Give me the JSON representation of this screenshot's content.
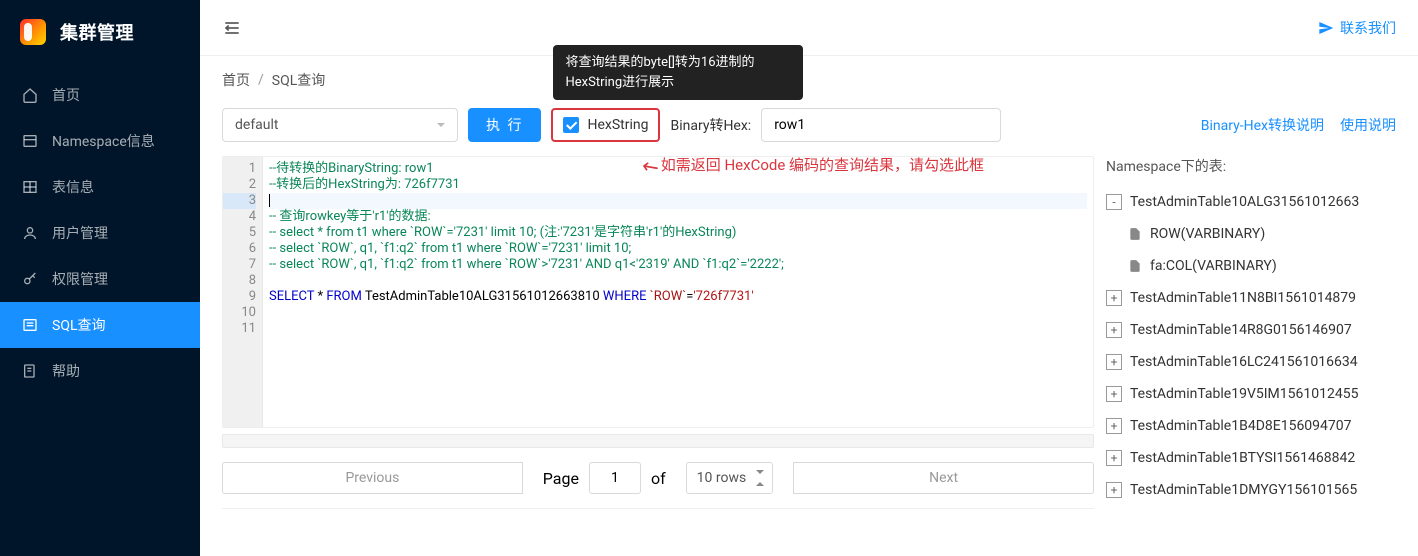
{
  "logo": {
    "title": "集群管理"
  },
  "sidebar": {
    "items": [
      {
        "label": "首页",
        "icon": "home-icon",
        "active": false
      },
      {
        "label": "Namespace信息",
        "icon": "list-icon",
        "active": false
      },
      {
        "label": "表信息",
        "icon": "table-icon",
        "active": false
      },
      {
        "label": "用户管理",
        "icon": "user-icon",
        "active": false
      },
      {
        "label": "权限管理",
        "icon": "key-icon",
        "active": false
      },
      {
        "label": "SQL查询",
        "icon": "sql-icon",
        "active": true
      },
      {
        "label": "帮助",
        "icon": "help-icon",
        "active": false
      }
    ]
  },
  "topbar": {
    "contact": "联系我们"
  },
  "breadcrumb": {
    "home": "首页",
    "current": "SQL查询"
  },
  "controls": {
    "namespace_select": "default",
    "execute_label": "执 行",
    "hexstring_label": "HexString",
    "hexstring_tooltip": "将查询结果的byte[]转为16进制的HexString进行展示",
    "binary_label": "Binary转Hex:",
    "binary_input": "row1",
    "link_convert": "Binary-Hex转换说明",
    "link_usage": "使用说明",
    "annotation": "如需返回 HexCode 编码的查询结果，请勾选此框"
  },
  "editor": {
    "lines": [
      {
        "n": 1,
        "html": "<span class='c-cmt'>--待转换的BinaryString: row1</span>"
      },
      {
        "n": 2,
        "html": "<span class='c-cmt'>--转换后的HexString为: 726f7731</span>"
      },
      {
        "n": 3,
        "html": "<span class='cursor'></span>",
        "cur": true
      },
      {
        "n": 4,
        "html": "<span class='c-cmt'>-- 查询rowkey等于'r1'的数据:</span>"
      },
      {
        "n": 5,
        "html": "<span class='c-cmt'>-- select * from t1 where `ROW`='7231' limit 10; (注:'7231'是字符串'r1'的HexString)</span>"
      },
      {
        "n": 6,
        "html": "<span class='c-cmt'>-- select `ROW`, q1, `f1:q2` from t1 where `ROW`='7231' limit 10;</span>"
      },
      {
        "n": 7,
        "html": "<span class='c-cmt'>-- select `ROW`, q1, `f1:q2` from t1 where `ROW`>'7231' AND q1<'2319' AND `f1:q2`='2222';</span>"
      },
      {
        "n": 8,
        "html": ""
      },
      {
        "n": 9,
        "html": "<span class='c-kw'>SELECT</span> * <span class='c-kw'>FROM</span> TestAdminTable10ALG31561012663810 <span class='c-kw'>WHERE</span> <span class='c-col'>`ROW`</span>=<span class='c-str'>'726f7731'</span>"
      },
      {
        "n": 10,
        "html": ""
      },
      {
        "n": 11,
        "html": ""
      }
    ]
  },
  "pager": {
    "prev": "Previous",
    "next": "Next",
    "page_label": "Page",
    "page_value": "1",
    "of_label": "of",
    "rows_label": "10 rows"
  },
  "tree": {
    "title": "Namespace下的表:",
    "root": "TestAdminTable10ALG31561012663",
    "leaves": [
      "ROW(VARBINARY)",
      "fa:COL(VARBINARY)"
    ],
    "siblings": [
      "TestAdminTable11N8BI1561014879",
      "TestAdminTable14R8G0156146907",
      "TestAdminTable16LC241561016634",
      "TestAdminTable19V5IM1561012455",
      "TestAdminTable1B4D8E156094707",
      "TestAdminTable1BTYSI1561468842",
      "TestAdminTable1DMYGY156101565"
    ]
  }
}
